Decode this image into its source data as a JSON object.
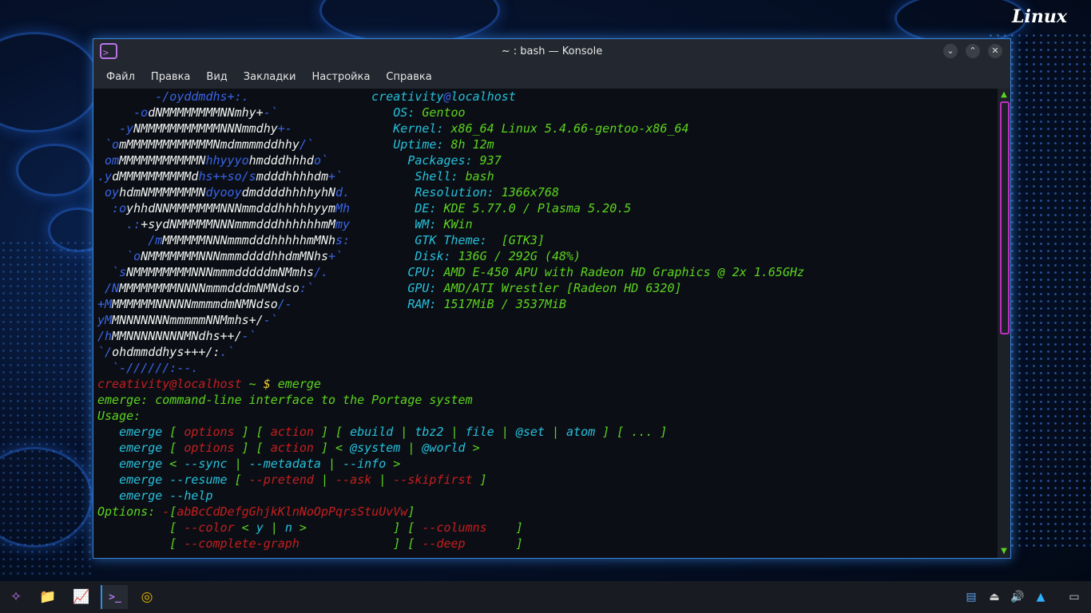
{
  "desktop": {
    "label": "Linux"
  },
  "window": {
    "title": "~ : bash — Konsole",
    "app_icon": ">_",
    "controls": [
      "⌄",
      "⌃",
      "✕"
    ]
  },
  "menu": [
    "Файл",
    "Правка",
    "Вид",
    "Закладки",
    "Настройка",
    "Справка"
  ],
  "terminal_lines": [
    [
      [
        "c-blue",
        "        -/oyddmdhs+:.                 "
      ],
      [
        "c-cyan",
        "creativity"
      ],
      [
        "c-blue",
        "@"
      ],
      [
        "c-cyan",
        "localhost"
      ]
    ],
    [
      [
        "c-blue",
        "     -o"
      ],
      [
        "c-white",
        "dNMMMMMMMMNNmhy+"
      ],
      [
        "c-blue",
        "-`"
      ],
      [
        "c-white",
        "                "
      ],
      [
        "c-cyan",
        "OS: "
      ],
      [
        "c-green",
        "Gentoo"
      ]
    ],
    [
      [
        "c-blue",
        "   -y"
      ],
      [
        "c-white",
        "NMMMMMMMMMMMNNNmmdhy"
      ],
      [
        "c-blue",
        "+-"
      ],
      [
        "c-white",
        "              "
      ],
      [
        "c-cyan",
        "Kernel: "
      ],
      [
        "c-green",
        "x86_64 Linux 5.4.66-gentoo-x86_64"
      ]
    ],
    [
      [
        "c-blue",
        " `o"
      ],
      [
        "c-white",
        "mMMMMMMMMMMMMNmdmmmmddhhy"
      ],
      [
        "c-blue",
        "/`"
      ],
      [
        "c-white",
        "           "
      ],
      [
        "c-cyan",
        "Uptime: "
      ],
      [
        "c-green",
        "8h 12m"
      ]
    ],
    [
      [
        "c-blue",
        " om"
      ],
      [
        "c-white",
        "MMMMMMMMMMMN"
      ],
      [
        "c-blue",
        "hhyyyo"
      ],
      [
        "c-white",
        "hmdddhhhd"
      ],
      [
        "c-blue",
        "o`"
      ],
      [
        "c-white",
        "           "
      ],
      [
        "c-cyan",
        "Packages: "
      ],
      [
        "c-green",
        "937"
      ]
    ],
    [
      [
        "c-blue",
        ".y"
      ],
      [
        "c-white",
        "dMMMMMMMMMMd"
      ],
      [
        "c-blue",
        "hs++so/s"
      ],
      [
        "c-white",
        "mdddhhhhdm"
      ],
      [
        "c-blue",
        "+`"
      ],
      [
        "c-white",
        "          "
      ],
      [
        "c-cyan",
        "Shell: "
      ],
      [
        "c-green",
        "bash"
      ]
    ],
    [
      [
        "c-blue",
        " oy"
      ],
      [
        "c-white",
        "hdmNMMMMMMMN"
      ],
      [
        "c-blue",
        "dyooy"
      ],
      [
        "c-white",
        "dmddddhhhhyhN"
      ],
      [
        "c-blue",
        "d."
      ],
      [
        "c-white",
        "         "
      ],
      [
        "c-cyan",
        "Resolution: "
      ],
      [
        "c-green",
        "1366x768"
      ]
    ],
    [
      [
        "c-blue",
        "  :o"
      ],
      [
        "c-white",
        "yhhdNNMMMMMMMNNNmmdddhhhhhyym"
      ],
      [
        "c-blue",
        "Mh"
      ],
      [
        "c-white",
        "         "
      ],
      [
        "c-cyan",
        "DE: "
      ],
      [
        "c-green",
        "KDE 5.77.0 / Plasma 5.20.5"
      ]
    ],
    [
      [
        "c-blue",
        "    .:"
      ],
      [
        "c-white",
        "+sydNMMMMMNNNmmmdddhhhhhhmM"
      ],
      [
        "c-blue",
        "my"
      ],
      [
        "c-white",
        "         "
      ],
      [
        "c-cyan",
        "WM: "
      ],
      [
        "c-green",
        "KWin"
      ]
    ],
    [
      [
        "c-blue",
        "       /m"
      ],
      [
        "c-white",
        "MMMMMMNNNmmmdddhhhhhmMNh"
      ],
      [
        "c-blue",
        "s:"
      ],
      [
        "c-white",
        "         "
      ],
      [
        "c-cyan",
        "GTK Theme: "
      ],
      [
        "c-green",
        " [GTK3]"
      ]
    ],
    [
      [
        "c-blue",
        "    `o"
      ],
      [
        "c-white",
        "NMMMMMMMNNNmmmddddhhdmMNhs"
      ],
      [
        "c-blue",
        "+`"
      ],
      [
        "c-white",
        "          "
      ],
      [
        "c-cyan",
        "Disk: "
      ],
      [
        "c-green",
        "136G / 292G (48%)"
      ]
    ],
    [
      [
        "c-blue",
        "  `s"
      ],
      [
        "c-white",
        "NMMMMMMMMNNNmmmdddddmNMmhs"
      ],
      [
        "c-blue",
        "/."
      ],
      [
        "c-white",
        "           "
      ],
      [
        "c-cyan",
        "CPU: "
      ],
      [
        "c-green",
        "AMD E-450 APU with Radeon HD Graphics @ 2x 1.65GHz"
      ]
    ],
    [
      [
        "c-blue",
        " /N"
      ],
      [
        "c-white",
        "MMMMMMMMNNNNmmmdddmNMNdso"
      ],
      [
        "c-blue",
        ":`"
      ],
      [
        "c-white",
        "             "
      ],
      [
        "c-cyan",
        "GPU: "
      ],
      [
        "c-green",
        "AMD/ATI Wrestler [Radeon HD 6320]"
      ]
    ],
    [
      [
        "c-blue",
        "+M"
      ],
      [
        "c-white",
        "MMMMMMNNNNNmmmmdmNMNdso"
      ],
      [
        "c-blue",
        "/-"
      ],
      [
        "c-white",
        "                "
      ],
      [
        "c-cyan",
        "RAM: "
      ],
      [
        "c-green",
        "1517MiB / 3537MiB"
      ]
    ],
    [
      [
        "c-blue",
        "yM"
      ],
      [
        "c-white",
        "MNNNNNNNmmmmmNNMmhs+/"
      ],
      [
        "c-blue",
        "-`"
      ]
    ],
    [
      [
        "c-blue",
        "/h"
      ],
      [
        "c-white",
        "MMNNNNNNNNMNdhs++/"
      ],
      [
        "c-blue",
        "-`"
      ]
    ],
    [
      [
        "c-blue",
        "`/"
      ],
      [
        "c-white",
        "ohdmmddhys+++/:"
      ],
      [
        "c-blue",
        ".`"
      ]
    ],
    [
      [
        "c-blue",
        "  `-//////:--."
      ]
    ],
    [
      [
        "c-red",
        "creativity"
      ],
      [
        "c-red",
        "@localhost"
      ],
      [
        "c-green",
        " ~ "
      ],
      [
        "c-yellow",
        "$ "
      ],
      [
        "c-green",
        "emerge"
      ]
    ],
    [
      [
        "c-green",
        "emerge: command-line interface to the Portage system"
      ]
    ],
    [
      [
        "c-green",
        "Usage:"
      ]
    ],
    [
      [
        "c-green",
        "   "
      ],
      [
        "c-cyan",
        "emerge"
      ],
      [
        "c-green",
        " [ "
      ],
      [
        "c-red",
        "options"
      ],
      [
        "c-green",
        " ] [ "
      ],
      [
        "c-red",
        "action"
      ],
      [
        "c-green",
        " ] [ "
      ],
      [
        "c-cyan",
        "ebuild"
      ],
      [
        "c-green",
        " | "
      ],
      [
        "c-cyan",
        "tbz2"
      ],
      [
        "c-green",
        " | "
      ],
      [
        "c-cyan",
        "file"
      ],
      [
        "c-green",
        " | "
      ],
      [
        "c-cyan",
        "@set"
      ],
      [
        "c-green",
        " | "
      ],
      [
        "c-cyan",
        "atom"
      ],
      [
        "c-green",
        " ] [ ... ]"
      ]
    ],
    [
      [
        "c-green",
        "   "
      ],
      [
        "c-cyan",
        "emerge"
      ],
      [
        "c-green",
        " [ "
      ],
      [
        "c-red",
        "options"
      ],
      [
        "c-green",
        " ] [ "
      ],
      [
        "c-red",
        "action"
      ],
      [
        "c-green",
        " ] < "
      ],
      [
        "c-cyan",
        "@system"
      ],
      [
        "c-green",
        " | "
      ],
      [
        "c-cyan",
        "@world"
      ],
      [
        "c-green",
        " >"
      ]
    ],
    [
      [
        "c-green",
        "   "
      ],
      [
        "c-cyan",
        "emerge"
      ],
      [
        "c-green",
        " < "
      ],
      [
        "c-cyan",
        "--sync"
      ],
      [
        "c-green",
        " | "
      ],
      [
        "c-cyan",
        "--metadata"
      ],
      [
        "c-green",
        " | "
      ],
      [
        "c-cyan",
        "--info"
      ],
      [
        "c-green",
        " >"
      ]
    ],
    [
      [
        "c-green",
        "   "
      ],
      [
        "c-cyan",
        "emerge --resume"
      ],
      [
        "c-green",
        " [ "
      ],
      [
        "c-red",
        "--pretend"
      ],
      [
        "c-green",
        " | "
      ],
      [
        "c-red",
        "--ask"
      ],
      [
        "c-green",
        " | "
      ],
      [
        "c-red",
        "--skipfirst"
      ],
      [
        "c-green",
        " ]"
      ]
    ],
    [
      [
        "c-green",
        "   "
      ],
      [
        "c-cyan",
        "emerge --help"
      ]
    ],
    [
      [
        "c-green",
        "Options: "
      ],
      [
        "c-red",
        "-"
      ],
      [
        "c-green",
        "["
      ],
      [
        "c-red",
        "abBcCdDefgGhjkKlnNoOpPqrsStuUvVw"
      ],
      [
        "c-green",
        "]"
      ]
    ],
    [
      [
        "c-green",
        "          [ "
      ],
      [
        "c-red",
        "--color"
      ],
      [
        "c-green",
        " < "
      ],
      [
        "c-cyan",
        "y"
      ],
      [
        "c-green",
        " | "
      ],
      [
        "c-cyan",
        "n"
      ],
      [
        "c-green",
        " >            ] [ "
      ],
      [
        "c-red",
        "--columns"
      ],
      [
        "c-green",
        "    ]"
      ]
    ],
    [
      [
        "c-green",
        "          [ "
      ],
      [
        "c-red",
        "--complete-graph"
      ],
      [
        "c-green",
        "             ] [ "
      ],
      [
        "c-red",
        "--deep"
      ],
      [
        "c-green",
        "       ]"
      ]
    ]
  ],
  "taskbar": {
    "apps": [
      {
        "name": "app-launcher",
        "glyph": "✧",
        "color": "#b874e6"
      },
      {
        "name": "file-manager",
        "glyph": "📁",
        "color": "#f08a3c"
      },
      {
        "name": "system-monitor",
        "glyph": "📈",
        "color": "#5aa0e8"
      },
      {
        "name": "konsole",
        "glyph": ">_",
        "color": "#b874e6"
      },
      {
        "name": "chrome",
        "glyph": "◎",
        "color": "#e0b000"
      }
    ],
    "tray": [
      {
        "name": "clipboard-icon",
        "glyph": "▤"
      },
      {
        "name": "usb-device-icon",
        "glyph": "⏏"
      },
      {
        "name": "volume-icon",
        "glyph": "🔊"
      },
      {
        "name": "tray-expand-icon",
        "glyph": "▲"
      },
      {
        "name": "show-desktop-icon",
        "glyph": "▭"
      }
    ]
  }
}
